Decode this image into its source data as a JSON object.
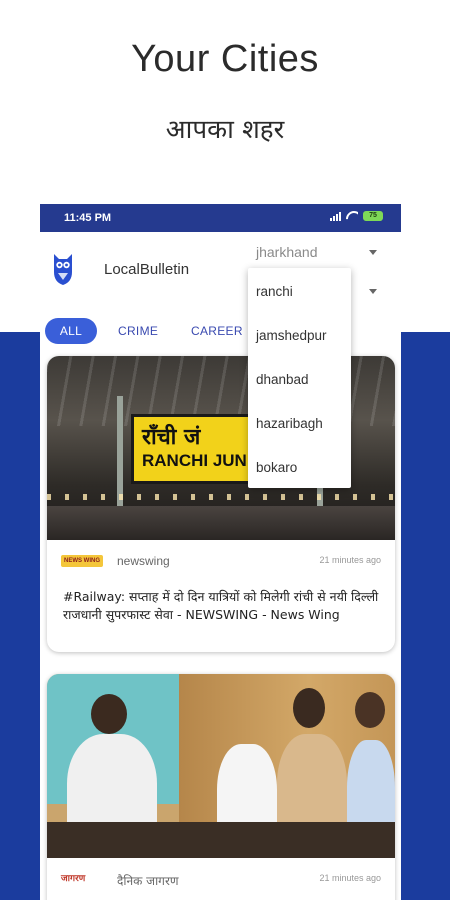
{
  "promo": {
    "title": "Your Cities",
    "subtitle": "आपका शहर"
  },
  "statusbar": {
    "time": "11:45 PM",
    "battery": "75"
  },
  "appbar": {
    "title": "LocalBulletin",
    "state_select_value": "jharkhand"
  },
  "tabs": [
    {
      "label": "ALL",
      "active": true
    },
    {
      "label": "CRIME",
      "active": false
    },
    {
      "label": "CAREER",
      "active": false
    }
  ],
  "city_dropdown": {
    "options": [
      "ranchi",
      "jamshedpur",
      "dhanbad",
      "hazaribagh",
      "bokaro"
    ]
  },
  "articles": [
    {
      "image_text_hi": "राँची जं",
      "image_text_en": "RANCHI JUN",
      "source": "newswing",
      "source_logo_text": "NEWS WING",
      "time": "21 minutes ago",
      "headline": "#Railway: सप्ताह में दो दिन यात्रियों को मिलेगी रांची से नयी दिल्ली राजधानी सुपरफास्ट सेवा - NEWSWING - News Wing"
    },
    {
      "source": "दैनिक जागरण",
      "source_logo_text": "जागरण",
      "time": "21 minutes ago"
    }
  ],
  "colors": {
    "brand_blue": "#1b3c9e",
    "statusbar": "#253a8f",
    "tab_active": "#3a5fd9",
    "board_yellow": "#f2d21a"
  }
}
